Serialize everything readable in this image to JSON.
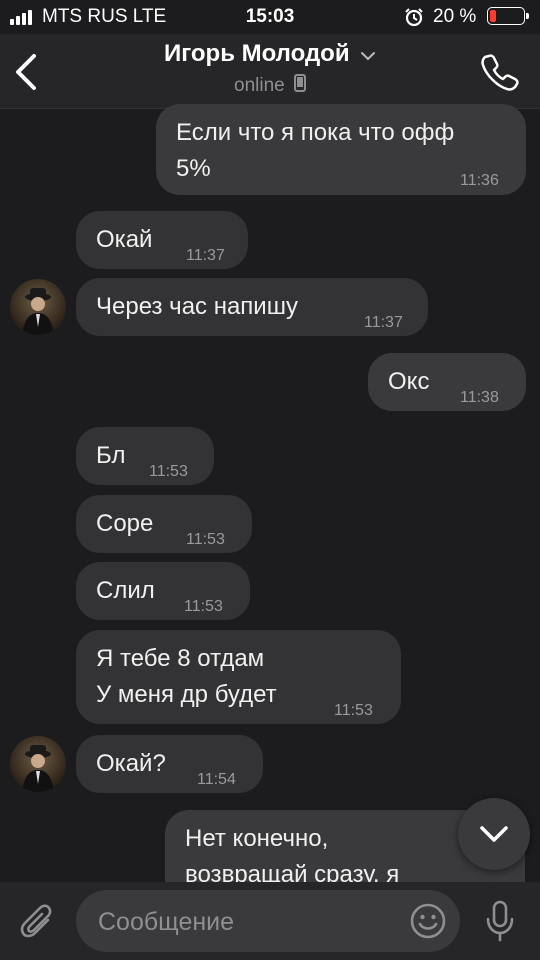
{
  "status_bar": {
    "carrier": "MTS RUS  LTE",
    "time": "15:03",
    "battery": "20 %",
    "battery_level": 0.2
  },
  "header": {
    "contact_name": "Игорь Молодой",
    "status": "online"
  },
  "messages": [
    {
      "dir": "out",
      "lines": [
        "Если что я пока что офф",
        "5%"
      ],
      "time": "11:36"
    },
    {
      "dir": "in",
      "lines": [
        "Окай"
      ],
      "time": "11:37"
    },
    {
      "dir": "in",
      "lines": [
        "Через час напишу"
      ],
      "time": "11:37",
      "avatar": true
    },
    {
      "dir": "out",
      "lines": [
        "Окс"
      ],
      "time": "11:38"
    },
    {
      "dir": "in",
      "lines": [
        "Бл"
      ],
      "time": "11:53"
    },
    {
      "dir": "in",
      "lines": [
        "Соре"
      ],
      "time": "11:53"
    },
    {
      "dir": "in",
      "lines": [
        "Слил"
      ],
      "time": "11:53"
    },
    {
      "dir": "in",
      "lines": [
        "Я тебе 8 отдам",
        "У меня др будет"
      ],
      "time": "11:53"
    },
    {
      "dir": "in",
      "lines": [
        "Окай?"
      ],
      "time": "11:54",
      "avatar": true
    },
    {
      "dir": "out",
      "lines": [
        "Нет конечно,",
        "возвращай сразу, я"
      ],
      "time": ""
    }
  ],
  "composer": {
    "placeholder": "Сообщение"
  },
  "colors": {
    "background": "#1c1c1e",
    "bubble_in": "#333335",
    "bubble_out": "#3a3a3c",
    "battery_low": "#ff3b30"
  },
  "icons": [
    "back-icon",
    "chevron-down-icon",
    "phone-icon",
    "call-icon",
    "paperclip-icon",
    "emoji-icon",
    "mic-icon",
    "scroll-down-icon"
  ]
}
